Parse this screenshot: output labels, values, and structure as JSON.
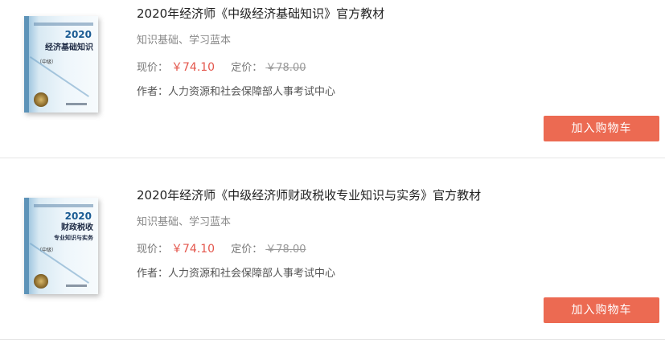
{
  "products": [
    {
      "title": "2020年经济师《中级经济基础知识》官方教材",
      "tags": "知识基础、学习蓝本",
      "price_label": "现价：",
      "price": "￥74.10",
      "list_price_label": "定价：",
      "list_price": "￥78.00",
      "author": "作者：人力资源和社会保障部人事考试中心",
      "button": "加入购物车",
      "cover": {
        "year": "2020",
        "title_lines": [
          "经济基础知识"
        ],
        "level": "（中级）"
      }
    },
    {
      "title": "2020年经济师《中级经济师财政税收专业知识与实务》官方教材",
      "tags": "知识基础、学习蓝本",
      "price_label": "现价：",
      "price": "￥74.10",
      "list_price_label": "定价：",
      "list_price": "￥78.00",
      "author": "作者：人力资源和社会保障部人事考试中心",
      "button": "加入购物车",
      "cover": {
        "year": "2020",
        "title_lines": [
          "财政税收",
          "专业知识与实务"
        ],
        "level": "（中级）"
      }
    }
  ],
  "colors": {
    "button": "#ec6a52",
    "price": "#e4574d",
    "cover_accent": "#1a5b93"
  }
}
